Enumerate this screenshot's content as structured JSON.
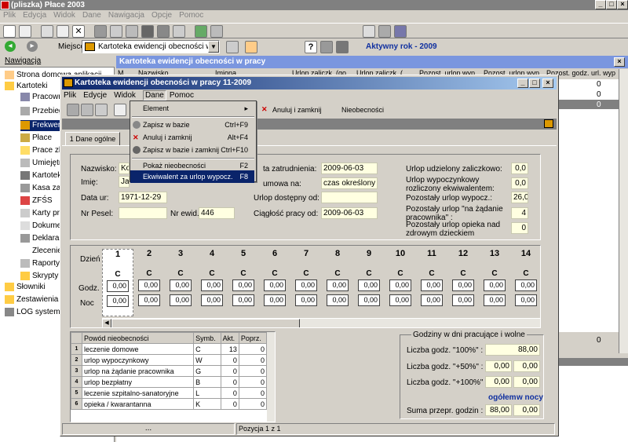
{
  "app": {
    "title": "(pliszka)  Płace 2003",
    "menu": [
      "Plik",
      "Edycja",
      "Widok",
      "Dane",
      "Nawigacja",
      "Opcje",
      "Pomoc"
    ],
    "location_label": "Miejsce",
    "location_value": "Kartoteka ewidencji obecności w pr...",
    "active_year": "Aktywny rok - 2009"
  },
  "nav": {
    "title": "Nawigacja",
    "items": [
      "Strona domowa aplikacji",
      "Kartoteki",
      "Pracowni",
      "Przebieg",
      "Frekwen",
      "Płace",
      "Prace zle",
      "Umiejętn",
      "Kartotek",
      "Kasa zap",
      "ZFŚS",
      "Karty pr",
      "Dokume",
      "Deklarac",
      "Zlecenie",
      "Raporty",
      "Skrypty",
      "Słowniki",
      "Zestawienia",
      "LOG systemo"
    ]
  },
  "bg_window": {
    "title": "Kartoteka ewidencji obecności w pracy",
    "cols": [
      "M",
      "Nazwisko",
      "Imiona",
      "Urlop zaliczk. (go",
      "Urlop zaliczk. (",
      "Pozost. urlop wyp",
      "Pozost. urlop wyp",
      "Pozost. godz. url. wyp"
    ],
    "right_vals": [
      "0",
      "0",
      "0"
    ],
    "bottom_val": "0"
  },
  "win": {
    "title": "Kartoteka ewidencji obecności w pracy 11-2009",
    "menu": [
      "Plik",
      "Edycje",
      "Widok",
      "Dane",
      "Pomoc"
    ],
    "tb_btn1": "Anuluj i zamknij",
    "tb_btn2": "Nieobecności",
    "tab": "1 Dane ogólne",
    "labels": {
      "surname": "Nazwisko:",
      "name": "Imię:",
      "dob": "Data ur:",
      "pesel": "Nr Pesel:",
      "ewid": "Nr ewid.:",
      "hire": "ta zatrudnienia:",
      "contract": "umowa na:",
      "leave_avail": "Urlop dostępny od:",
      "continuity": "Ciągłość pracy od:",
      "advance": "Urlop udzielony zaliczkowo:",
      "paid_eq": "Urlop wypoczynkowy rozliczony ekwiwalentem:",
      "remaining": "Pozostały urlop wypocz.:",
      "on_demand": "Pozostały urlop \"na żądanie pracownika\" :",
      "childcare": "Pozostały urlop opieka nad zdrowym dzieckiem"
    },
    "values": {
      "surname": "Ko",
      "name": "Ja",
      "dob": "1971-12-29",
      "pesel": "",
      "ewid": "446",
      "hire": "2009-06-03",
      "contract": "czas określony",
      "leave_avail": "",
      "continuity": "2009-06-03",
      "advance": "0,0",
      "paid_eq": "0,0",
      "remaining": "26,0",
      "on_demand": "4",
      "childcare": "0"
    },
    "day_labels": {
      "day": "Dzień",
      "hours": "Godz.",
      "night": "Noc"
    },
    "days": [
      {
        "n": "1",
        "c": "C",
        "g": "0,00",
        "nc": "0,00"
      },
      {
        "n": "2",
        "c": "C",
        "g": "0,00",
        "nc": "0,00"
      },
      {
        "n": "3",
        "c": "C",
        "g": "0,00",
        "nc": "0,00"
      },
      {
        "n": "4",
        "c": "C",
        "g": "0,00",
        "nc": "0,00"
      },
      {
        "n": "5",
        "c": "C",
        "g": "0,00",
        "nc": "0,00"
      },
      {
        "n": "6",
        "c": "C",
        "g": "0,00",
        "nc": "0,00"
      },
      {
        "n": "7",
        "c": "C",
        "g": "0,00",
        "nc": "0,00"
      },
      {
        "n": "8",
        "c": "C",
        "g": "0,00",
        "nc": "0,00"
      },
      {
        "n": "9",
        "c": "C",
        "g": "0,00",
        "nc": "0,00"
      },
      {
        "n": "10",
        "c": "C",
        "g": "0,00",
        "nc": "0,00"
      },
      {
        "n": "11",
        "c": "C",
        "g": "0,00",
        "nc": "0,00"
      },
      {
        "n": "12",
        "c": "C",
        "g": "0,00",
        "nc": "0,00"
      },
      {
        "n": "13",
        "c": "C",
        "g": "0,00",
        "nc": "0,00"
      },
      {
        "n": "14",
        "c": "C",
        "g": "0,00",
        "nc": "0,00"
      }
    ],
    "reasons_head": [
      "Powód nieobecności",
      "Symb.",
      "Akt.",
      "Poprz."
    ],
    "reasons": [
      {
        "n": "1",
        "r": "leczenie domowe",
        "s": "C",
        "a": "13",
        "p": "0"
      },
      {
        "n": "2",
        "r": "urlop wypoczynkowy",
        "s": "W",
        "a": "0",
        "p": "0"
      },
      {
        "n": "3",
        "r": "urlop na żądanie pracownika",
        "s": "G",
        "a": "0",
        "p": "0"
      },
      {
        "n": "4",
        "r": "urlop bezpłatny",
        "s": "B",
        "a": "0",
        "p": "0"
      },
      {
        "n": "5",
        "r": "leczenie szpitalno-sanatoryjne",
        "s": "L",
        "a": "0",
        "p": "0"
      },
      {
        "n": "6",
        "r": "opieka / kwarantanna",
        "s": "K",
        "a": "0",
        "p": "0"
      }
    ],
    "hours": {
      "title": "Godziny w dni pracujące i wolne",
      "l100": "Liczba godz. \"100%\" :",
      "v100": "88,00",
      "l50": "Liczba godz. \"+50%\" :",
      "v50a": "0,00",
      "v50b": "0,00",
      "l100p": "Liczba godz. \"+100%\" :",
      "v100a": "0,00",
      "v100b": "0,00",
      "total": "ogółem",
      "night": "w nocy",
      "sum": "Suma przepr. godzin :",
      "suma": "88,00",
      "sumb": "0,00"
    },
    "status": {
      "dots": "...",
      "pos": "Pozycja 1 z 1"
    }
  },
  "dropdown": {
    "items": [
      {
        "l": "Element",
        "sc": "▸"
      },
      {
        "l": "Zapisz w bazie",
        "sc": "Ctrl+F9"
      },
      {
        "l": "Anuluj i zamknij",
        "sc": "Alt+F4"
      },
      {
        "l": "Zapisz w bazie i  zamknij",
        "sc": "Ctrl+F10"
      },
      {
        "l": "Pokaż nieobecności",
        "sc": "F2"
      },
      {
        "l": "Ekwiwalent za urlop wypocz.",
        "sc": "F8"
      }
    ]
  }
}
